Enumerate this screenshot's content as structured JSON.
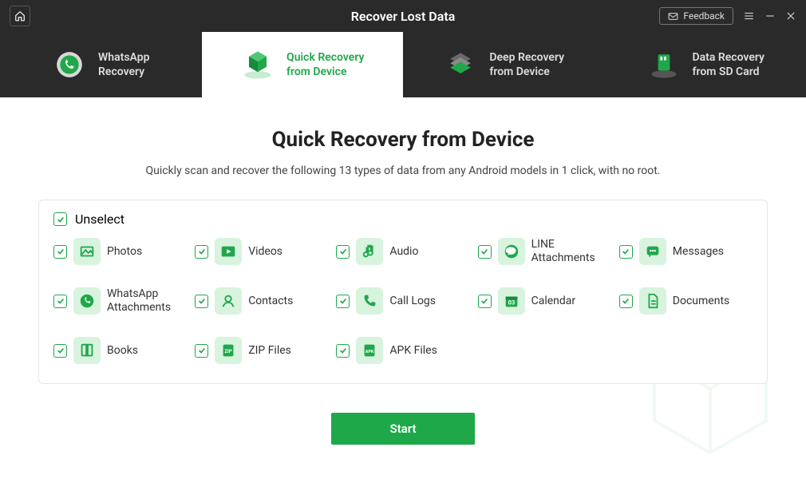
{
  "header": {
    "title": "Recover Lost Data",
    "feedback_label": "Feedback"
  },
  "tabs": [
    {
      "line1": "WhatsApp",
      "line2": "Recovery"
    },
    {
      "line1": "Quick Recovery",
      "line2": "from Device"
    },
    {
      "line1": "Deep Recovery",
      "line2": "from Device"
    },
    {
      "line1": "Data Recovery",
      "line2": "from SD Card"
    }
  ],
  "main": {
    "title": "Quick Recovery from Device",
    "subtitle": "Quickly scan and recover the following 13 types of data from any Android models in 1 click, with no root.",
    "unselect_label": "Unselect",
    "items": [
      {
        "label": "Photos"
      },
      {
        "label": "Videos"
      },
      {
        "label": "Audio"
      },
      {
        "label": "LINE Attachments"
      },
      {
        "label": "Messages"
      },
      {
        "label": "WhatsApp Attachments"
      },
      {
        "label": "Contacts"
      },
      {
        "label": "Call Logs"
      },
      {
        "label": "Calendar"
      },
      {
        "label": "Documents"
      },
      {
        "label": "Books"
      },
      {
        "label": "ZIP Files"
      },
      {
        "label": "APK Files"
      }
    ],
    "start_label": "Start"
  }
}
